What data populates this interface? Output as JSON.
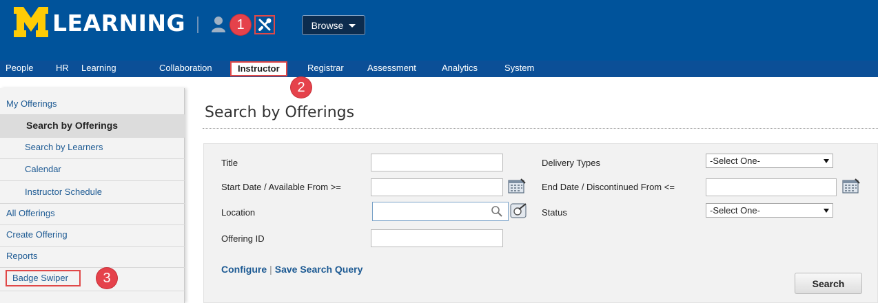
{
  "header": {
    "logo_letter": "M",
    "logo_text": "LEARNING",
    "browse_label": "Browse",
    "person_icon": "user-icon",
    "tools_icon": "tools-icon",
    "colors": {
      "banner": "#00539b",
      "maize": "#ffcb05",
      "callout": "#e5424b"
    }
  },
  "callouts": {
    "one": "1",
    "two": "2",
    "three": "3"
  },
  "nav": {
    "items": [
      "People",
      "HR",
      "Learning",
      "Collaboration",
      "Instructor",
      "Registrar",
      "Assessment",
      "Analytics",
      "System"
    ],
    "active": "Instructor"
  },
  "sidebar": {
    "items": [
      {
        "label": "My Offerings"
      },
      {
        "label": "Search by Offerings"
      },
      {
        "label": "Search by Learners"
      },
      {
        "label": "Calendar"
      },
      {
        "label": "Instructor Schedule"
      },
      {
        "label": "All Offerings"
      },
      {
        "label": "Create Offering"
      },
      {
        "label": "Reports"
      },
      {
        "label": "Badge Swiper"
      }
    ],
    "selected": "Search by Offerings"
  },
  "main": {
    "title": "Search by Offerings",
    "form": {
      "title_label": "Title",
      "title_value": "",
      "start_label": "Start Date / Available From >=",
      "start_value": "",
      "location_label": "Location",
      "location_value": "",
      "offering_id_label": "Offering ID",
      "offering_id_value": "",
      "delivery_label": "Delivery Types",
      "delivery_value": "-Select One-",
      "end_label": "End Date / Discontinued From <=",
      "end_value": "",
      "status_label": "Status",
      "status_value": "-Select One-"
    },
    "links": {
      "configure": "Configure",
      "save_query": "Save Search Query"
    },
    "search_button": "Search"
  }
}
